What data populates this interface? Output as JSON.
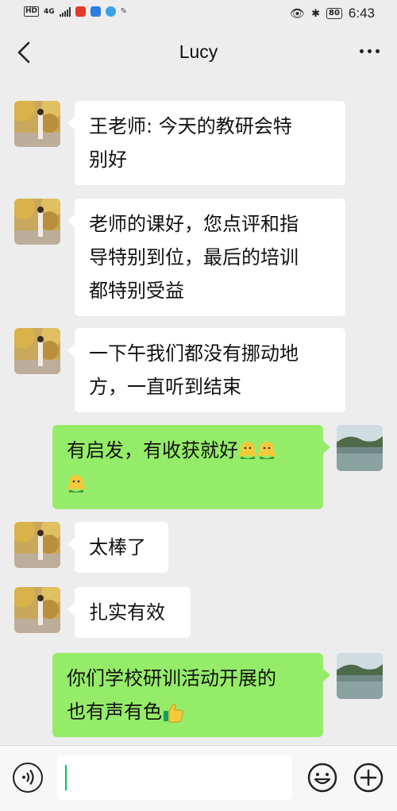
{
  "status_bar": {
    "left_badges": [
      "HD",
      "4G"
    ],
    "time": "6:43",
    "battery": "80"
  },
  "header": {
    "title": "Lucy",
    "back_icon": "chevron-left-icon",
    "more_icon": "more-dots-icon"
  },
  "messages": [
    {
      "side": "in",
      "lines": [
        "王老师: 今天的教研会特",
        "别好"
      ]
    },
    {
      "side": "in",
      "lines": [
        "老师的课好，您点评和指",
        "导特别到位，最后的培训",
        "都特别受益"
      ]
    },
    {
      "side": "in",
      "lines": [
        "一下午我们都没有挪动地",
        "方，一直听到结束"
      ]
    },
    {
      "side": "out",
      "lines": [
        "有启发，有收获就好"
      ],
      "emoji": "hug-emoji x3"
    },
    {
      "side": "in",
      "lines": [
        "太棒了"
      ]
    },
    {
      "side": "in",
      "lines": [
        "扎实有效"
      ]
    },
    {
      "side": "out",
      "lines": [
        "你们学校研训活动开展的",
        "也有声有色"
      ],
      "emoji": "thumbs-up-emoji"
    }
  ],
  "input_bar": {
    "value": "",
    "voice_icon": "voice-icon",
    "emoji_icon": "emoji-icon",
    "plus_icon": "plus-icon"
  },
  "colors": {
    "background": "#ededed",
    "incoming_bubble": "#ffffff",
    "outgoing_bubble": "#95ec69",
    "caret": "#07c160"
  }
}
